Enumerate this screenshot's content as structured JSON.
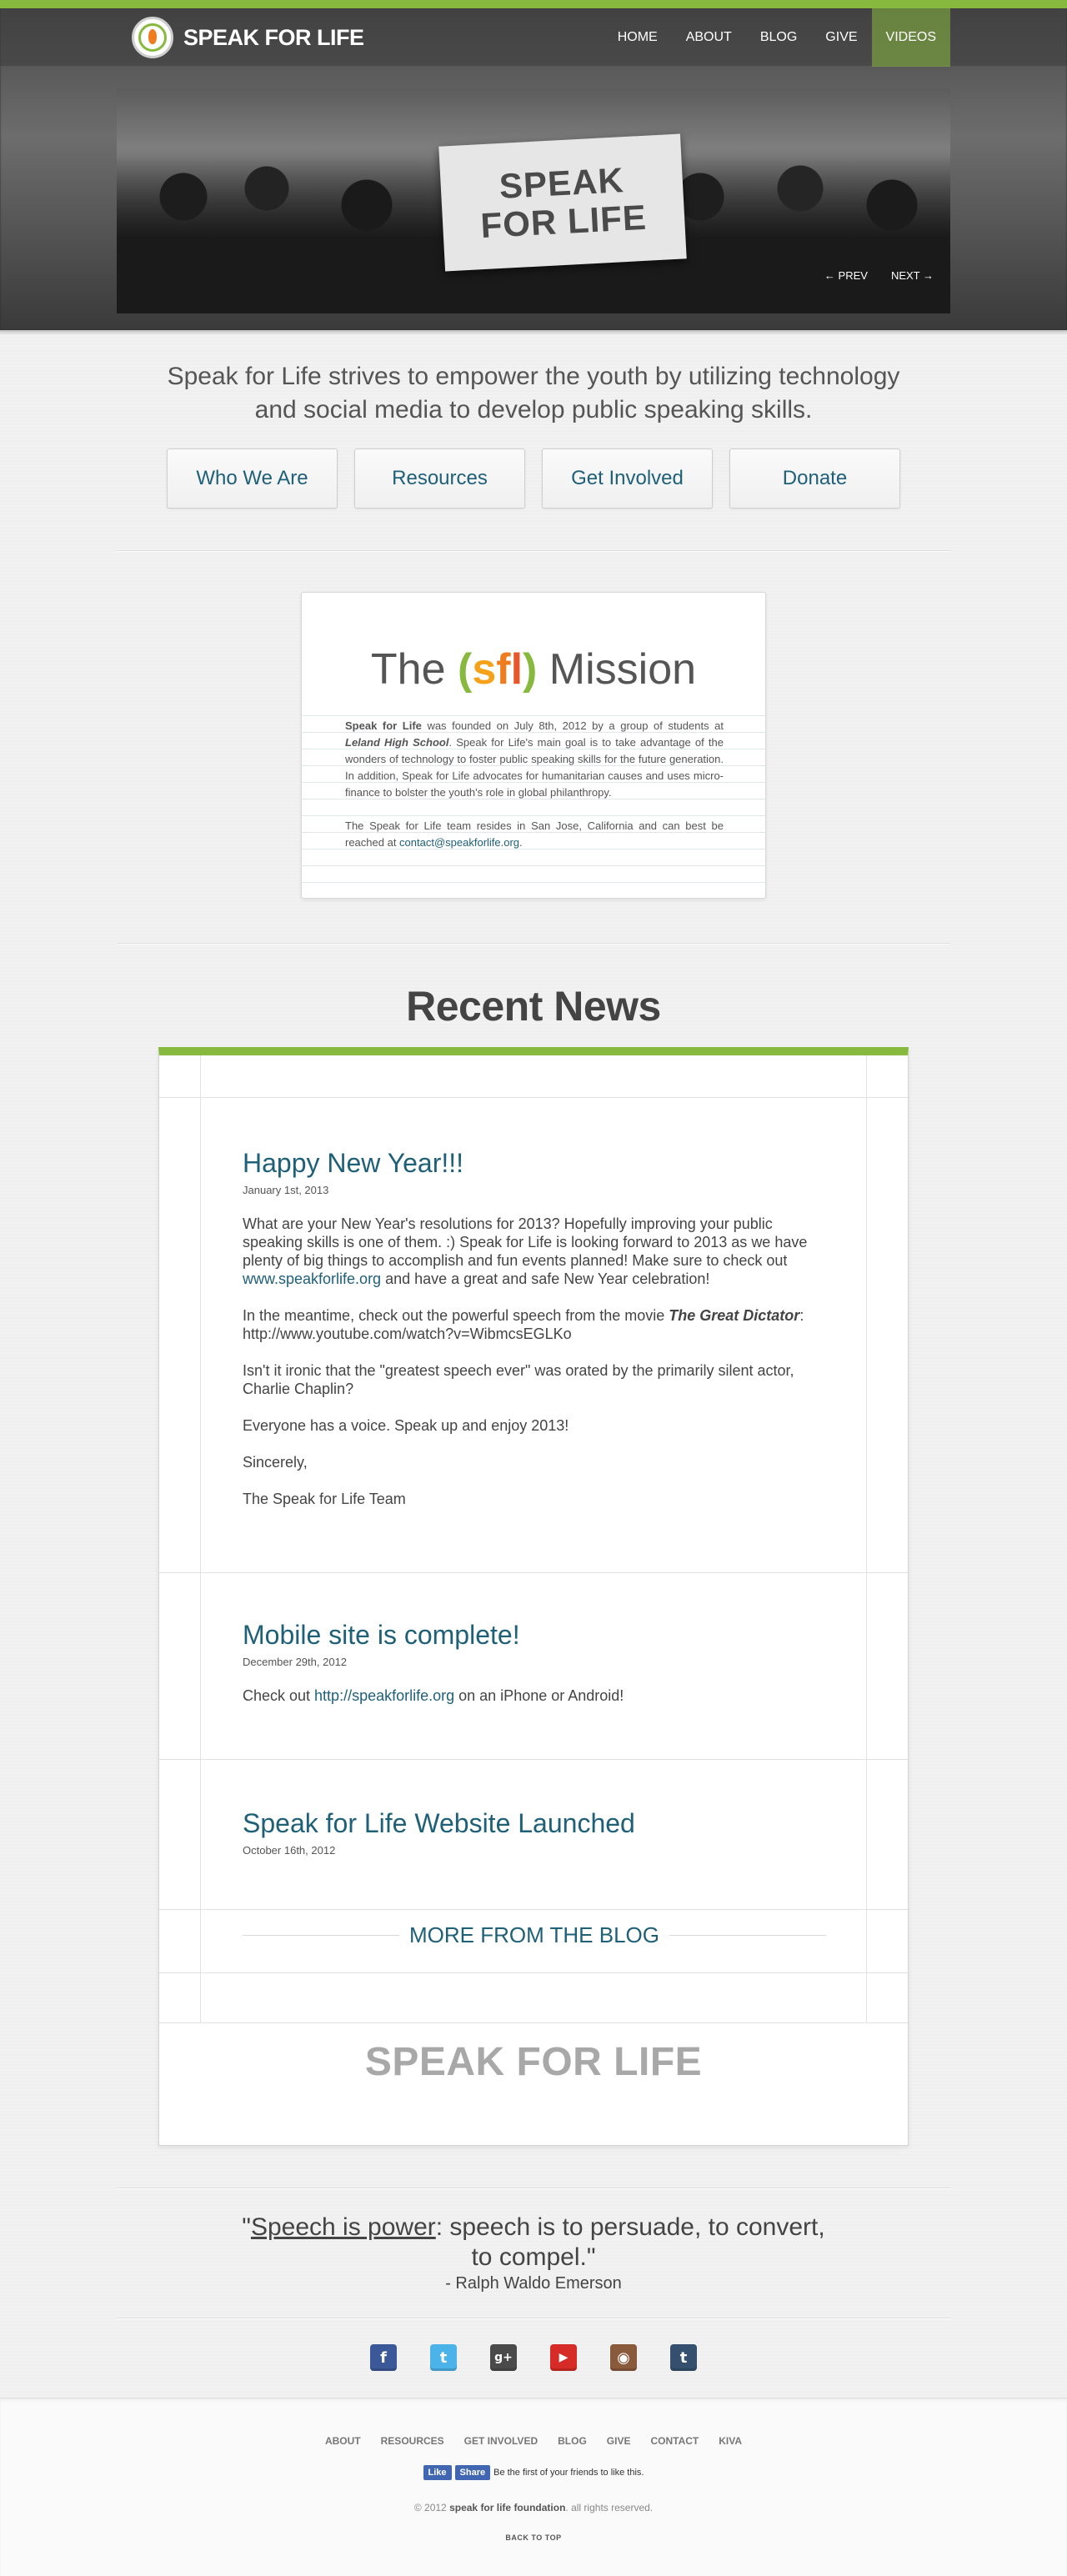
{
  "header": {
    "brand": "SPEAK FOR LIFE",
    "nav": [
      "HOME",
      "ABOUT",
      "BLOG",
      "GIVE",
      "VIDEOS"
    ],
    "active_nav": "VIDEOS"
  },
  "hero": {
    "banner_line1": "SPEAK",
    "banner_line2": "FOR LIFE",
    "prev": "← PREV",
    "next": "NEXT →"
  },
  "tagline": "Speak for Life strives to empower the youth by utilizing technology and social media to develop public speaking skills.",
  "buttons": [
    "Who We Are",
    "Resources",
    "Get Involved",
    "Donate"
  ],
  "mission": {
    "title_pre": "The",
    "title_paren_open": "(",
    "title_s": "s",
    "title_f": "f",
    "title_l": "l",
    "title_paren_close": ")",
    "title_post": "Mission",
    "p1_bold": "Speak for Life",
    "p1_a": " was founded on July 8th, 2012 by a group of students at ",
    "p1_italic": "Leland High School",
    "p1_b": ". Speak for Life's main goal is to take advantage of the wonders of technology to foster public speaking skills for the future generation. In addition, Speak for Life advocates for humanitarian causes and uses micro-finance to bolster the youth's role in global philanthropy.",
    "p2_a": "The Speak for Life team resides in San Jose, California and can best be reached at ",
    "p2_email": "contact@speakforlife.org",
    "p2_b": "."
  },
  "news": {
    "heading": "Recent News",
    "posts": [
      {
        "title": "Happy New Year!!!",
        "date": "January 1st, 2013",
        "p1_a": "What are your New Year's resolutions for 2013? Hopefully improving your public speaking skills is one of them. :) Speak for Life is looking forward to 2013 as we have plenty of big things to accomplish and fun events planned! Make sure to check out ",
        "p1_link": "www.speakforlife.org",
        "p1_b": " and have a great and safe New Year celebration!",
        "p2_a": "In the meantime, check out the powerful speech from the movie ",
        "p2_italic": "The Great Dictator",
        "p2_b": ": http://www.youtube.com/watch?v=WibmcsEGLKo",
        "p3": "Isn't it ironic that the \"greatest speech ever\" was orated by the primarily silent actor, Charlie Chaplin?",
        "p4": "Everyone has a voice. Speak up and enjoy 2013!",
        "p5": "Sincerely,",
        "p6": "The Speak for Life Team"
      },
      {
        "title": "Mobile site is complete!",
        "date": "December 29th, 2012",
        "p1_a": "Check out ",
        "p1_link": "http://speakforlife.org",
        "p1_b": " on an iPhone or Android!"
      },
      {
        "title": "Speak for Life Website Launched",
        "date": "October 16th, 2012"
      }
    ],
    "more": "MORE FROM THE BLOG",
    "footer_brand": "SPEAK FOR LIFE"
  },
  "quote": {
    "open": "\"",
    "underlined": "Speech is power",
    "rest": ": speech is to persuade, to convert, to compel.\"",
    "author": "- Ralph Waldo Emerson"
  },
  "social": [
    {
      "name": "facebook",
      "glyph": "f",
      "color": "#3b5998"
    },
    {
      "name": "twitter",
      "glyph": "t",
      "color": "#4bb3e8"
    },
    {
      "name": "google-plus",
      "glyph": "g+",
      "color": "#4a4a4a"
    },
    {
      "name": "youtube",
      "glyph": "▶",
      "color": "#d62b26"
    },
    {
      "name": "instagram",
      "glyph": "◉",
      "color": "#8a5a3c"
    },
    {
      "name": "tumblr",
      "glyph": "t",
      "color": "#35506e"
    }
  ],
  "footer": {
    "nav": [
      "ABOUT",
      "RESOURCES",
      "GET INVOLVED",
      "BLOG",
      "GIVE",
      "CONTACT",
      "KIVA"
    ],
    "fb_like": "Like",
    "fb_share": "Share",
    "fb_text": "Be the first of your friends to like this.",
    "copyright_a": "© 2012 ",
    "copyright_bold": "speak for life foundation",
    "copyright_b": ". all rights reserved.",
    "back_to_top": "BACK TO TOP"
  },
  "colors": {
    "accent_green": "#86b93e",
    "link_blue": "#1f6079"
  }
}
